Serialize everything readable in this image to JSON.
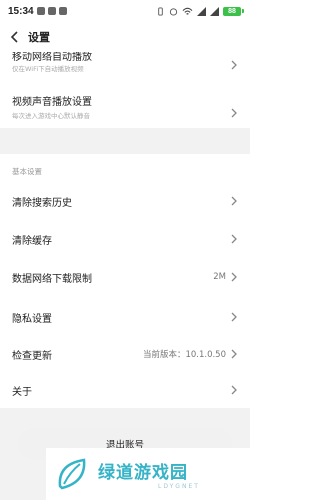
{
  "status_bar": {
    "time": "15:34",
    "battery": "88",
    "icons": [
      "notification-icon",
      "notification-icon",
      "notification-icon",
      "vibrate-icon",
      "alarm-icon",
      "wifi-icon",
      "signal-icon",
      "signal-icon",
      "battery-icon"
    ]
  },
  "header": {
    "title": "设置",
    "back_icon": "chevron-left-icon"
  },
  "video_section": {
    "autoplay": {
      "label": "移动网络自动播放",
      "sublabel": "仅在WiFi下自动播放视频"
    },
    "sound": {
      "label": "视频声音播放设置",
      "sublabel": "每次进入游戏中心默认静音"
    }
  },
  "basic_section": {
    "title": "基本设置",
    "items": [
      {
        "label": "清除搜索历史",
        "value": ""
      },
      {
        "label": "清除缓存",
        "value": ""
      },
      {
        "label": "数据网络下载限制",
        "value": "2M"
      },
      {
        "label": "隐私设置",
        "value": ""
      },
      {
        "label": "检查更新",
        "value": "当前版本：10.1.0.50"
      },
      {
        "label": "关于",
        "value": ""
      }
    ]
  },
  "logout_button": {
    "label": "退出账号"
  },
  "watermark": {
    "text": "绿道游戏园",
    "url": "LDYGNET"
  },
  "colors": {
    "accent_green": "#3cc04a",
    "watermark_teal": "#35b3c7",
    "divider": "#f2f2f2"
  }
}
